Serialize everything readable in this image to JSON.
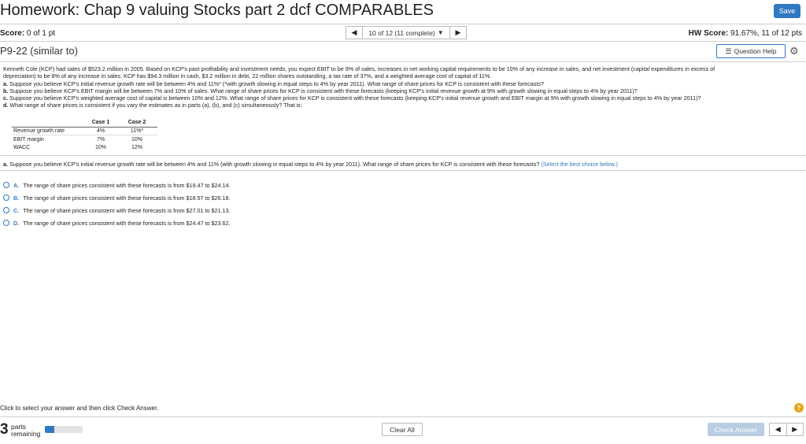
{
  "header": {
    "title": "Homework: Chap 9 valuing Stocks part 2 dcf COMPARABLES",
    "save_label": "Save"
  },
  "score": {
    "label": "Score:",
    "value": "0 of 1 pt"
  },
  "navigation": {
    "prev_icon": "triangle-left-icon",
    "status": "10 of 12 (11 complete)",
    "next_icon": "triangle-right-icon"
  },
  "hw_score": {
    "label": "HW Score:",
    "value": "91.67%, 11 of 12 pts"
  },
  "problem": {
    "id": "P9-22 (similar to)",
    "question_help_label": "Question Help",
    "lines": [
      "Kenneth Cole (KCP) had sales of $523.2 million in 2005. Based on KCP's past profitability and investment needs, you expect EBIT to be 9% of sales, increases in net working capital requirements to be 10% of any increase in sales, and net investment (capital expenditures in excess of",
      "depreciation) to be 8% of any increase in sales. KCP has $94.3 million in cash, $3.2 million in debt, 22 million shares outstanding, a tax rate of 37%, and a weighted average cost of capital of 11%."
    ],
    "parts": [
      {
        "letter": "a.",
        "text": "Suppose you believe KCP's initial revenue growth rate will be between 4% and 11%* (*with growth slowing in equal steps to 4% by year 2011). What range of share prices for KCP is consistent with these forecasts?"
      },
      {
        "letter": "b.",
        "text": "Suppose you believe KCP's EBIT margin will be between 7% and 10% of sales. What range of share prices for KCP is consistent with these forecasts (keeping KCP's initial revenue growth at 9% with growth slowing in equal steps to 4% by year 2011)?"
      },
      {
        "letter": "c.",
        "text": "Suppose you believe KCP's weighted average cost of capital is between 10% and 12%. What range of share prices for KCP is consistent with these forecasts (keeping KCP's initial revenue growth and EBIT margin at 9% with growth slowing in equal steps to 4% by year 2011)?"
      },
      {
        "letter": "d.",
        "text": "What range of share prices is consistent if you vary the estimates as in parts (a), (b), and (c) simultaneously? That is:"
      }
    ]
  },
  "cases_table": {
    "headers": [
      "",
      "Case 1",
      "Case 2"
    ],
    "rows": [
      [
        "Revenue growth rate",
        "4%",
        "11%*"
      ],
      [
        "EBIT margin",
        "7%",
        "10%"
      ],
      [
        "WACC",
        "10%",
        "12%"
      ]
    ]
  },
  "part_a": {
    "letter": "a.",
    "question": "Suppose you believe KCP's initial revenue growth rate will be between 4% and 11% (with growth slowing in equal steps to 4% by year 2011). What range of share prices for KCP is consistent with these forecasts?",
    "hint": "(Select the best choice below.)"
  },
  "choices": [
    {
      "letter": "A.",
      "text": "The range of share prices consistent with these forecasts is from $19.47 to $24.14."
    },
    {
      "letter": "B.",
      "text": "The range of share prices consistent with these forecasts is from $18.57 to $26.18."
    },
    {
      "letter": "C.",
      "text": "The range of share prices consistent with these forecasts is from $27.01 to $21.13."
    },
    {
      "letter": "D.",
      "text": "The range of share prices consistent with these forecasts is from $24.47 to $23.62."
    }
  ],
  "footer": {
    "instruction": "Click to select your answer and then click Check Answer.",
    "help_symbol": "?",
    "parts_count": "3",
    "parts_line1": "parts",
    "parts_line2": "remaining",
    "progress_fraction": 0.25,
    "clear_all_label": "Clear All",
    "check_answer_label": "Check Answer",
    "check_answer_enabled": false
  },
  "colors": {
    "accent": "#2f79c2",
    "check_answer_disabled": "#b9cde2",
    "help_icon": "#e8a317"
  }
}
